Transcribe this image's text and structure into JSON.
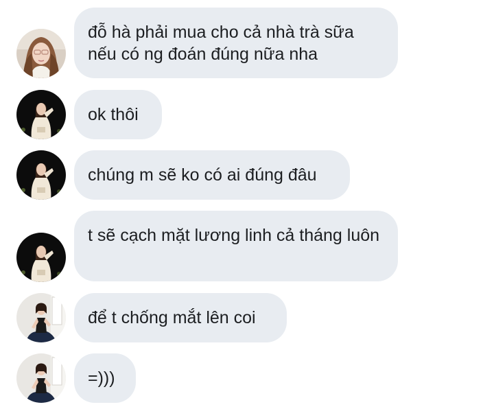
{
  "messages": [
    {
      "avatar": "avatar-girl-glasses",
      "text": "đỗ hà phải mua cho cả nhà trà sữa nếu có ng đoán đúng nữa nha"
    },
    {
      "avatar": "avatar-girl-dark",
      "text": "ok thôi"
    },
    {
      "avatar": "avatar-girl-dark",
      "text": "chúng m sẽ ko có ai đúng đâu"
    },
    {
      "avatar": "avatar-girl-dark",
      "text": "t sẽ cạch mặt lương linh cả tháng luôn"
    },
    {
      "avatar": "avatar-girl-dress",
      "text": "để t chống mắt lên coi"
    },
    {
      "avatar": "avatar-girl-dress",
      "text": "=)))"
    }
  ],
  "colors": {
    "bubble_bg": "#e8ecf1",
    "text": "#1c1e21",
    "background": "#ffffff"
  }
}
